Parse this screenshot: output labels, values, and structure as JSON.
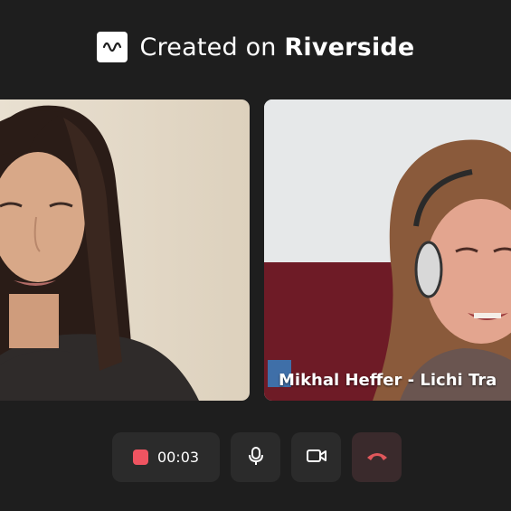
{
  "banner": {
    "prefix": "Created on",
    "brand": "Riverside",
    "logo_icon": "waveform-logo-icon"
  },
  "participants": [
    {
      "name": "",
      "video": "participant-video-left"
    },
    {
      "name": "Mikhal Heffer - Lichi Tra",
      "video": "participant-video-right"
    }
  ],
  "controls": {
    "record_timer": "00:03",
    "record_icon": "record-icon",
    "mic_icon": "microphone-icon",
    "camera_icon": "camera-icon",
    "end_call_icon": "end-call-icon"
  },
  "colors": {
    "background": "#1e1e1e",
    "control_bg": "#2b2b2b",
    "record_red": "#ef5461",
    "end_call_red": "#e0575b"
  }
}
